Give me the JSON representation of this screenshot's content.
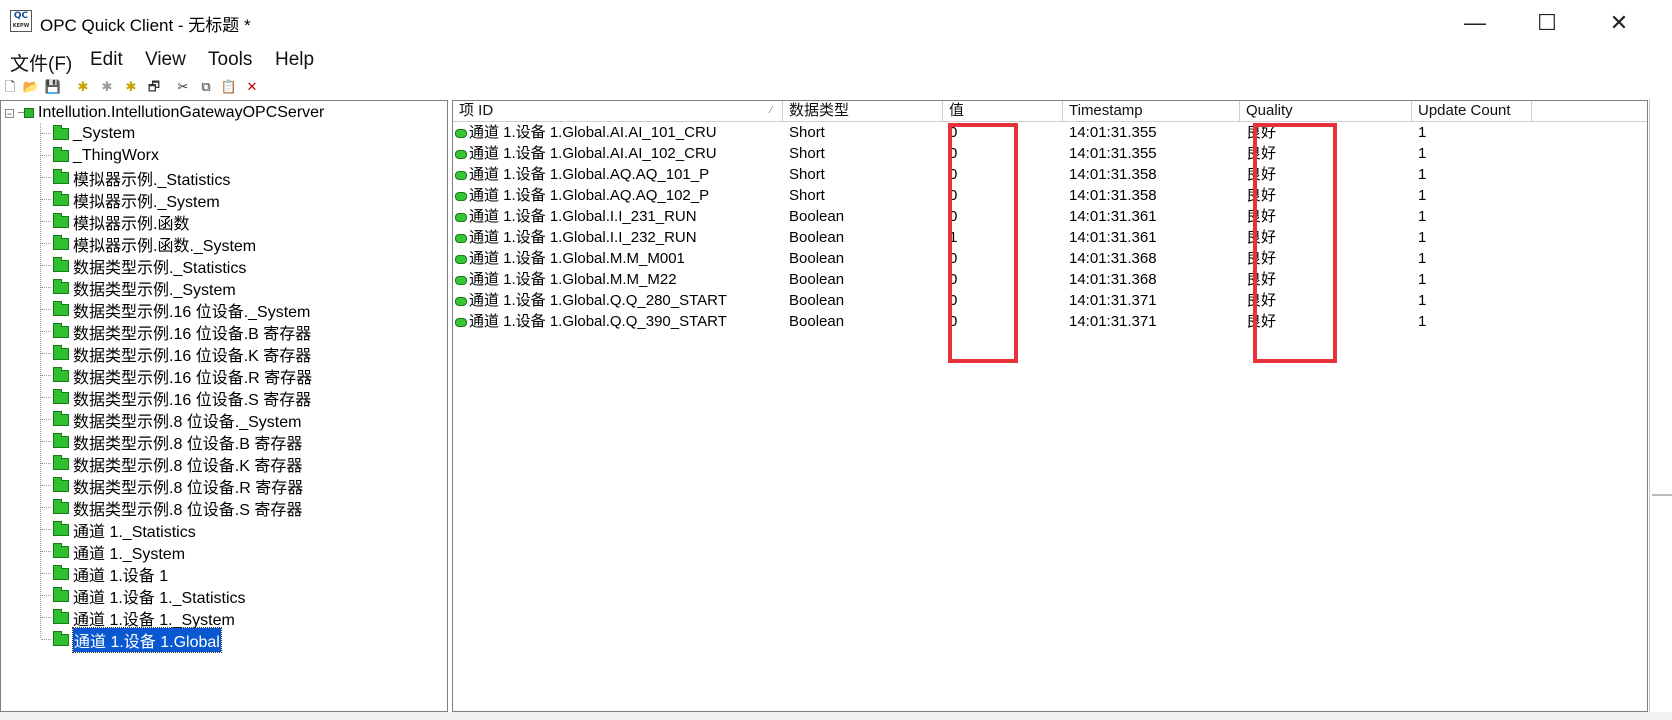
{
  "window": {
    "title": "OPC Quick Client - 无标题 *",
    "icon_text_top": "QC",
    "icon_text_bottom": "KEPW",
    "minimize_glyph": "—",
    "maximize_glyph": "☐",
    "close_glyph": "✕"
  },
  "menu": {
    "items": [
      "文件(F)",
      "Edit",
      "View",
      "Tools",
      "Help"
    ]
  },
  "toolbar": {
    "icons": [
      "new-icon",
      "open-icon",
      "save-icon",
      "new-server-icon",
      "new-group-icon",
      "new-item-icon",
      "properties-icon",
      "cut-icon",
      "copy-icon",
      "paste-icon",
      "delete-icon"
    ],
    "glyphs": [
      "🗋",
      "📂",
      "💾",
      "✱",
      "✱",
      "✱",
      "🗗",
      "✂",
      "⧉",
      "📋",
      "✕"
    ]
  },
  "tree": {
    "root": {
      "label": "Intellution.IntellutionGatewayOPCServer",
      "expander": "−"
    },
    "items": [
      {
        "label": "_System"
      },
      {
        "label": "_ThingWorx"
      },
      {
        "label": "模拟器示例._Statistics"
      },
      {
        "label": "模拟器示例._System"
      },
      {
        "label": "模拟器示例.函数"
      },
      {
        "label": "模拟器示例.函数._System"
      },
      {
        "label": "数据类型示例._Statistics"
      },
      {
        "label": "数据类型示例._System"
      },
      {
        "label": "数据类型示例.16 位设备._System"
      },
      {
        "label": "数据类型示例.16 位设备.B 寄存器"
      },
      {
        "label": "数据类型示例.16 位设备.K 寄存器"
      },
      {
        "label": "数据类型示例.16 位设备.R 寄存器"
      },
      {
        "label": "数据类型示例.16 位设备.S 寄存器"
      },
      {
        "label": "数据类型示例.8 位设备._System"
      },
      {
        "label": "数据类型示例.8 位设备.B 寄存器"
      },
      {
        "label": "数据类型示例.8 位设备.K 寄存器"
      },
      {
        "label": "数据类型示例.8 位设备.R 寄存器"
      },
      {
        "label": "数据类型示例.8 位设备.S 寄存器"
      },
      {
        "label": "通道 1._Statistics"
      },
      {
        "label": "通道 1._System"
      },
      {
        "label": "通道 1.设备 1"
      },
      {
        "label": "通道 1.设备 1._Statistics"
      },
      {
        "label": "通道 1.设备 1._System"
      },
      {
        "label": "通道 1.设备 1.Global",
        "selected": true
      }
    ]
  },
  "list": {
    "sort_glyph": "⁄",
    "columns": [
      "项 ID",
      "数据类型",
      "值",
      "Timestamp",
      "Quality",
      "Update Count"
    ],
    "rows": [
      {
        "id": "通道 1.设备 1.Global.AI.AI_101_CRU",
        "type": "Short",
        "value": "0",
        "timestamp": "14:01:31.355",
        "quality": "良好",
        "count": "1"
      },
      {
        "id": "通道 1.设备 1.Global.AI.AI_102_CRU",
        "type": "Short",
        "value": "0",
        "timestamp": "14:01:31.355",
        "quality": "良好",
        "count": "1"
      },
      {
        "id": "通道 1.设备 1.Global.AQ.AQ_101_P",
        "type": "Short",
        "value": "0",
        "timestamp": "14:01:31.358",
        "quality": "良好",
        "count": "1"
      },
      {
        "id": "通道 1.设备 1.Global.AQ.AQ_102_P",
        "type": "Short",
        "value": "0",
        "timestamp": "14:01:31.358",
        "quality": "良好",
        "count": "1"
      },
      {
        "id": "通道 1.设备 1.Global.I.I_231_RUN",
        "type": "Boolean",
        "value": "0",
        "timestamp": "14:01:31.361",
        "quality": "良好",
        "count": "1"
      },
      {
        "id": "通道 1.设备 1.Global.I.I_232_RUN",
        "type": "Boolean",
        "value": "1",
        "timestamp": "14:01:31.361",
        "quality": "良好",
        "count": "1"
      },
      {
        "id": "通道 1.设备 1.Global.M.M_M001",
        "type": "Boolean",
        "value": "0",
        "timestamp": "14:01:31.368",
        "quality": "良好",
        "count": "1"
      },
      {
        "id": "通道 1.设备 1.Global.M.M_M22",
        "type": "Boolean",
        "value": "0",
        "timestamp": "14:01:31.368",
        "quality": "良好",
        "count": "1"
      },
      {
        "id": "通道 1.设备 1.Global.Q.Q_280_START",
        "type": "Boolean",
        "value": "0",
        "timestamp": "14:01:31.371",
        "quality": "良好",
        "count": "1"
      },
      {
        "id": "通道 1.设备 1.Global.Q.Q_390_START",
        "type": "Boolean",
        "value": "0",
        "timestamp": "14:01:31.371",
        "quality": "良好",
        "count": "1"
      }
    ]
  },
  "colors": {
    "highlight_box": "#e8323a",
    "selection": "#0a58d0",
    "item_icon": "#36c536"
  }
}
